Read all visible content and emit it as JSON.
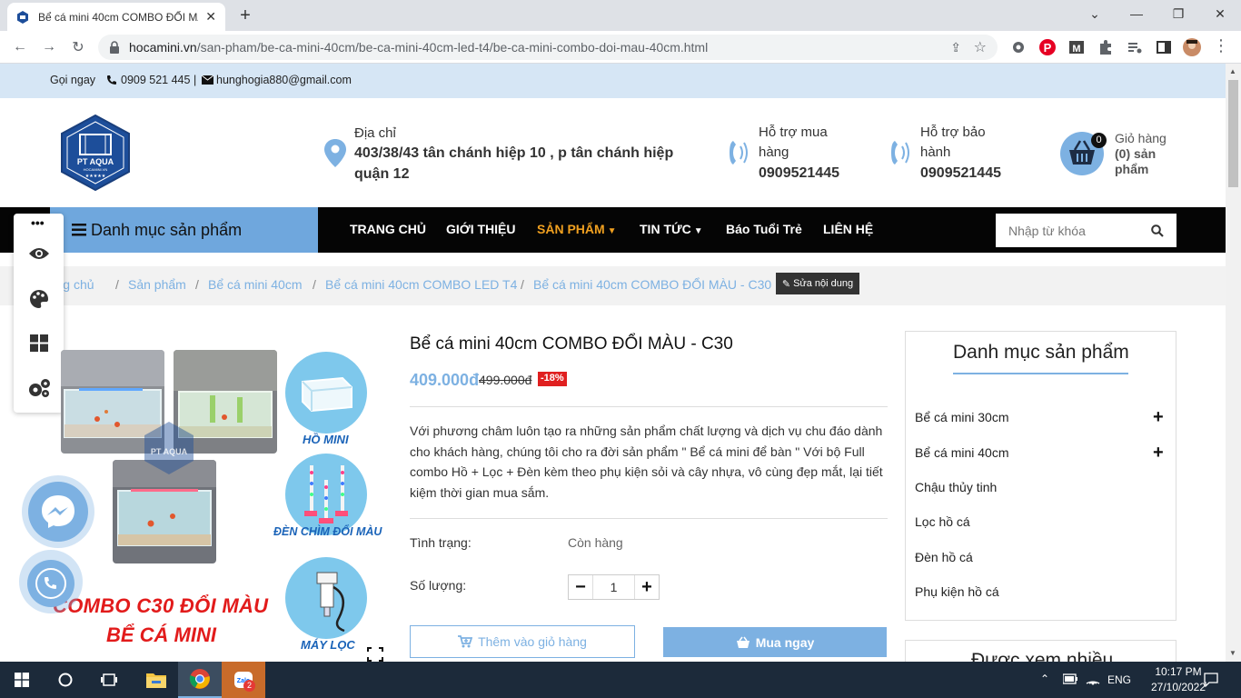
{
  "browser": {
    "tab_title": "Bể cá mini 40cm COMBO ĐỔI MÀU",
    "url_host": "hocamini.vn",
    "url_path": "/san-pham/be-ca-mini-40cm/be-ca-mini-40cm-led-t4/be-ca-mini-combo-doi-mau-40cm.html"
  },
  "topbar": {
    "call_label": "Gọi ngay",
    "phone": "0909 521 445",
    "separator": "|",
    "email": "hunghogia880@gmail.com"
  },
  "logo": {
    "text": "PT AQUA",
    "sub": "HOCAMINI.VN",
    "stars": "★★★★★"
  },
  "header": {
    "address_label": "Địa chỉ",
    "address_value": "403/38/43 tân chánh hiệp 10 , p tân chánh hiệp quận 12",
    "support_buy_label": "Hỗ trợ mua hàng",
    "support_buy_phone": "0909521445",
    "support_warranty_label": "Hỗ trợ bảo hành",
    "support_warranty_phone": "0909521445",
    "cart_label": "Giỏ hàng",
    "cart_count_text": "(0) sản phẩm",
    "cart_badge": "0"
  },
  "nav": {
    "category_button": "Danh mục sản phẩm",
    "items": [
      "TRANG CHỦ",
      "GIỚI THIỆU",
      "SẢN PHẨM",
      "TIN TỨC",
      "Báo Tuổi Trẻ",
      "LIÊN HỆ"
    ],
    "search_placeholder": "Nhập từ khóa",
    "active_color": "#f0a020"
  },
  "breadcrumb": {
    "items": [
      "Trang chủ",
      "Sản phẩm",
      "Bể cá mini 40cm",
      "Bể cá mini 40cm COMBO LED T4",
      "Bể cá mini 40cm COMBO ĐỔI MÀU - C30"
    ],
    "separator": "/",
    "edit_button": "Sửa nội dung"
  },
  "product": {
    "title": "Bể cá mini 40cm COMBO ĐỔI MÀU - C30",
    "price": "409.000đ",
    "old_price": "499.000đ",
    "discount": "-18%",
    "description": "Với phương châm luôn tạo ra những sản phẩm chất lượng và dịch vụ chu đáo dành cho khách hàng, chúng tôi cho ra đời sản phẩm \" Bể cá mini để bàn \" Với bộ Full combo Hồ + Lọc + Đèn kèm theo phụ kiện sỏi và cây nhựa, vô cùng đẹp mắt, lại tiết kiệm thời gian mua sắm.",
    "status_label": "Tình trạng:",
    "status_value": "Còn hàng",
    "quantity_label": "Số lượng:",
    "quantity_value": "1",
    "add_to_cart": "Thêm vào giỏ hàng",
    "buy_now": "Mua ngay"
  },
  "image_labels": {
    "ho": "HỒ MINI",
    "den": "ĐÈN CHÌM ĐỔI MÀU",
    "may": "MÁY LỌC",
    "combo_line1": "COMBO C30 ĐỔI MÀU",
    "combo_line2": "BỂ CÁ MINI"
  },
  "sidebar": {
    "title": "Danh mục sản phẩm",
    "items": [
      "Bể cá mini 30cm",
      "Bể cá mini 40cm",
      "Chậu thủy tinh",
      "Lọc hồ cá",
      "Đèn hồ cá",
      "Phụ kiện hồ cá"
    ],
    "viewed_title": "Được xem nhiều"
  },
  "taskbar": {
    "language": "ENG",
    "time": "10:17 PM",
    "date": "27/10/2022",
    "zalo_badge": "2"
  },
  "colors": {
    "accent": "#7db1e2",
    "topbar_bg": "#d6e6f5",
    "nav_bg": "#050505",
    "category_bg": "#6fa7dd",
    "discount_bg": "#e02020"
  }
}
